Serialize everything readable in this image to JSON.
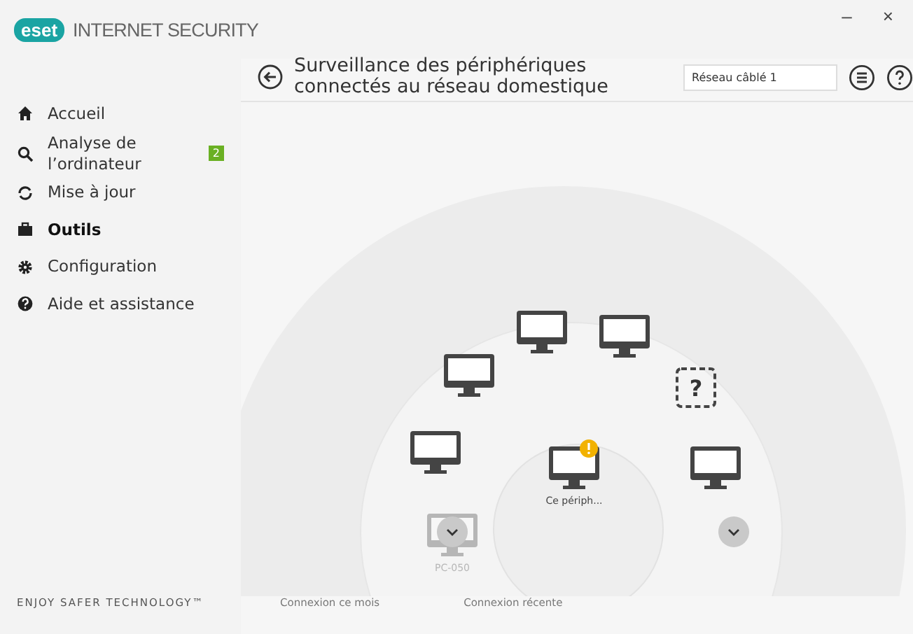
{
  "window": {
    "logo": "eset",
    "title": "INTERNET SECURITY",
    "controls": [
      "–",
      "×"
    ]
  },
  "sidebar": {
    "items": [
      {
        "label": "Accueil",
        "selected": false
      },
      {
        "label": "Analyse de l’ordinateur",
        "selected": false,
        "badge": "2"
      },
      {
        "label": "Mise à jour",
        "selected": false
      },
      {
        "label": "Outils",
        "selected": true
      },
      {
        "label": "Configuration",
        "selected": false
      },
      {
        "label": "Aide et assistance",
        "selected": false
      }
    ],
    "footer": "ENJOY SAFER TECHNOLOGY™"
  },
  "header": {
    "title": "Surveillance des périphériques connectés au réseau domestique",
    "network": "Réseau câblé 1"
  },
  "devices": [
    {
      "kind": "monitor",
      "warning": false,
      "faded": false
    },
    {
      "kind": "monitor",
      "warning": false,
      "faded": false
    },
    {
      "kind": "monitor",
      "warning": false,
      "faded": false
    },
    {
      "kind": "unknown",
      "warning": false,
      "faded": false,
      "glyph": "?"
    },
    {
      "kind": "monitor",
      "warning": false,
      "faded": false
    },
    {
      "kind": "monitor",
      "warning": true,
      "faded": false,
      "label": "Ce périph..."
    },
    {
      "kind": "monitor",
      "warning": false,
      "faded": false
    },
    {
      "kind": "monitor",
      "warning": false,
      "faded": true,
      "label": "PC-050"
    }
  ],
  "legend": [
    "Connexion ce mois",
    "Connexion récente"
  ]
}
